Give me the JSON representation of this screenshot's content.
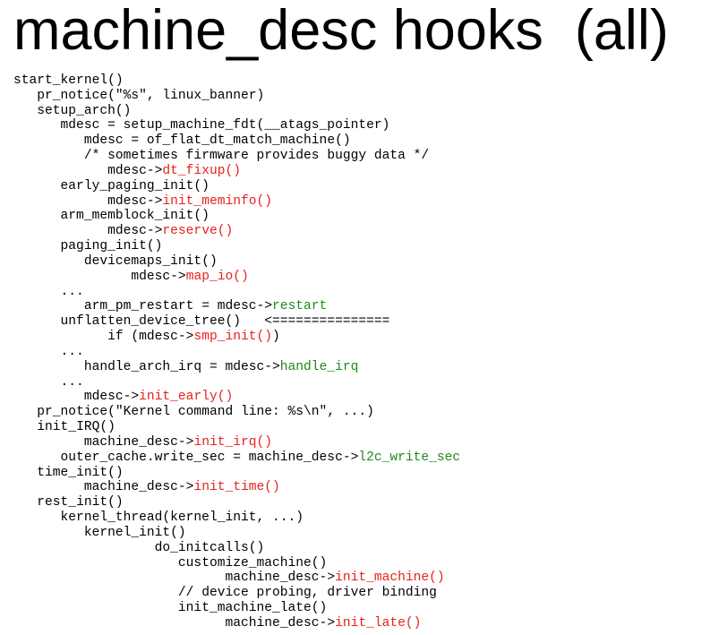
{
  "slide": {
    "title": "machine_desc hooks  (all)"
  },
  "colors": {
    "text": "#000000",
    "hook_call": "#e8211b",
    "hook_field": "#1c8a1c",
    "background": "#ffffff"
  },
  "code_lines": [
    {
      "indent": 0,
      "segments": [
        {
          "text": "start_kernel()",
          "style": "plain"
        }
      ]
    },
    {
      "indent": 3,
      "segments": [
        {
          "text": "pr_notice(\"%s\", linux_banner)",
          "style": "plain"
        }
      ]
    },
    {
      "indent": 3,
      "segments": [
        {
          "text": "setup_arch()",
          "style": "plain"
        }
      ]
    },
    {
      "indent": 6,
      "segments": [
        {
          "text": "mdesc = setup_machine_fdt(__atags_pointer)",
          "style": "plain"
        }
      ]
    },
    {
      "indent": 9,
      "segments": [
        {
          "text": "mdesc = of_flat_dt_match_machine()",
          "style": "plain"
        }
      ]
    },
    {
      "indent": 9,
      "segments": [
        {
          "text": "/* sometimes firmware provides buggy data */",
          "style": "plain"
        }
      ]
    },
    {
      "indent": 12,
      "segments": [
        {
          "text": "mdesc->",
          "style": "plain"
        },
        {
          "text": "dt_fixup()",
          "style": "red"
        }
      ]
    },
    {
      "indent": 6,
      "segments": [
        {
          "text": "early_paging_init()",
          "style": "plain"
        }
      ]
    },
    {
      "indent": 12,
      "segments": [
        {
          "text": "mdesc->",
          "style": "plain"
        },
        {
          "text": "init_meminfo()",
          "style": "red"
        }
      ]
    },
    {
      "indent": 6,
      "segments": [
        {
          "text": "arm_memblock_init()",
          "style": "plain"
        }
      ]
    },
    {
      "indent": 12,
      "segments": [
        {
          "text": "mdesc->",
          "style": "plain"
        },
        {
          "text": "reserve()",
          "style": "red"
        }
      ]
    },
    {
      "indent": 6,
      "segments": [
        {
          "text": "paging_init()",
          "style": "plain"
        }
      ]
    },
    {
      "indent": 9,
      "segments": [
        {
          "text": "devicemaps_init()",
          "style": "plain"
        }
      ]
    },
    {
      "indent": 15,
      "segments": [
        {
          "text": "mdesc->",
          "style": "plain"
        },
        {
          "text": "map_io()",
          "style": "red"
        }
      ]
    },
    {
      "indent": 6,
      "segments": [
        {
          "text": "...",
          "style": "plain"
        }
      ]
    },
    {
      "indent": 9,
      "segments": [
        {
          "text": "arm_pm_restart = mdesc->",
          "style": "plain"
        },
        {
          "text": "restart",
          "style": "green"
        }
      ]
    },
    {
      "indent": 6,
      "segments": [
        {
          "text": "unflatten_device_tree()   <===============",
          "style": "plain"
        }
      ]
    },
    {
      "indent": 12,
      "segments": [
        {
          "text": "if (mdesc->",
          "style": "plain"
        },
        {
          "text": "smp_init()",
          "style": "red"
        },
        {
          "text": ")",
          "style": "plain"
        }
      ]
    },
    {
      "indent": 6,
      "segments": [
        {
          "text": "...",
          "style": "plain"
        }
      ]
    },
    {
      "indent": 9,
      "segments": [
        {
          "text": "handle_arch_irq = mdesc->",
          "style": "plain"
        },
        {
          "text": "handle_irq",
          "style": "green"
        }
      ]
    },
    {
      "indent": 6,
      "segments": [
        {
          "text": "...",
          "style": "plain"
        }
      ]
    },
    {
      "indent": 9,
      "segments": [
        {
          "text": "mdesc->",
          "style": "plain"
        },
        {
          "text": "init_early()",
          "style": "red"
        }
      ]
    },
    {
      "indent": 3,
      "segments": [
        {
          "text": "pr_notice(\"Kernel command line: %s\\n\", ...)",
          "style": "plain"
        }
      ]
    },
    {
      "indent": 3,
      "segments": [
        {
          "text": "init_IRQ()",
          "style": "plain"
        }
      ]
    },
    {
      "indent": 9,
      "segments": [
        {
          "text": "machine_desc->",
          "style": "plain"
        },
        {
          "text": "init_irq()",
          "style": "red"
        }
      ]
    },
    {
      "indent": 6,
      "segments": [
        {
          "text": "outer_cache.write_sec = machine_desc->",
          "style": "plain"
        },
        {
          "text": "l2c_write_sec",
          "style": "green"
        }
      ]
    },
    {
      "indent": 3,
      "segments": [
        {
          "text": "time_init()",
          "style": "plain"
        }
      ]
    },
    {
      "indent": 9,
      "segments": [
        {
          "text": "machine_desc->",
          "style": "plain"
        },
        {
          "text": "init_time()",
          "style": "red"
        }
      ]
    },
    {
      "indent": 3,
      "segments": [
        {
          "text": "rest_init()",
          "style": "plain"
        }
      ]
    },
    {
      "indent": 6,
      "segments": [
        {
          "text": "kernel_thread(kernel_init, ...)",
          "style": "plain"
        }
      ]
    },
    {
      "indent": 9,
      "segments": [
        {
          "text": "kernel_init()",
          "style": "plain"
        }
      ]
    },
    {
      "indent": 18,
      "segments": [
        {
          "text": "do_initcalls()",
          "style": "plain"
        }
      ]
    },
    {
      "indent": 21,
      "segments": [
        {
          "text": "customize_machine()",
          "style": "plain"
        }
      ]
    },
    {
      "indent": 27,
      "segments": [
        {
          "text": "machine_desc->",
          "style": "plain"
        },
        {
          "text": "init_machine()",
          "style": "red"
        }
      ]
    },
    {
      "indent": 21,
      "segments": [
        {
          "text": "// device probing, driver binding",
          "style": "plain"
        }
      ]
    },
    {
      "indent": 21,
      "segments": [
        {
          "text": "init_machine_late()",
          "style": "plain"
        }
      ]
    },
    {
      "indent": 27,
      "segments": [
        {
          "text": "machine_desc->",
          "style": "plain"
        },
        {
          "text": "init_late()",
          "style": "red"
        }
      ]
    }
  ]
}
